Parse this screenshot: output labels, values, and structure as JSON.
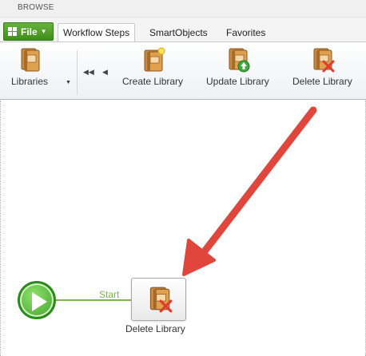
{
  "topbar": {
    "label": "BROWSE"
  },
  "file_menu": {
    "label": "File"
  },
  "tabs": [
    {
      "label": "Workflow Steps",
      "active": true
    },
    {
      "label": "SmartObjects",
      "active": false
    },
    {
      "label": "Favorites",
      "active": false
    }
  ],
  "ribbon": {
    "libraries": {
      "label": "Libraries",
      "icon": "books-icon"
    },
    "nav_first_icon": "double-chevron-left-icon",
    "nav_prev_icon": "chevron-left-icon",
    "create": {
      "label": "Create Library",
      "icon": "create-library-icon"
    },
    "update": {
      "label": "Update Library",
      "icon": "update-library-icon"
    },
    "delete": {
      "label": "Delete Library",
      "icon": "delete-library-icon"
    }
  },
  "designer": {
    "start_node_icon": "play-icon",
    "link_label": "Start",
    "step": {
      "label": "Delete Library",
      "icon": "delete-library-icon"
    }
  },
  "colors": {
    "file_button": "#4a9c25",
    "link_line": "#7ab648",
    "start_node": "#3ea32a",
    "annotation_arrow": "#e0463c"
  }
}
